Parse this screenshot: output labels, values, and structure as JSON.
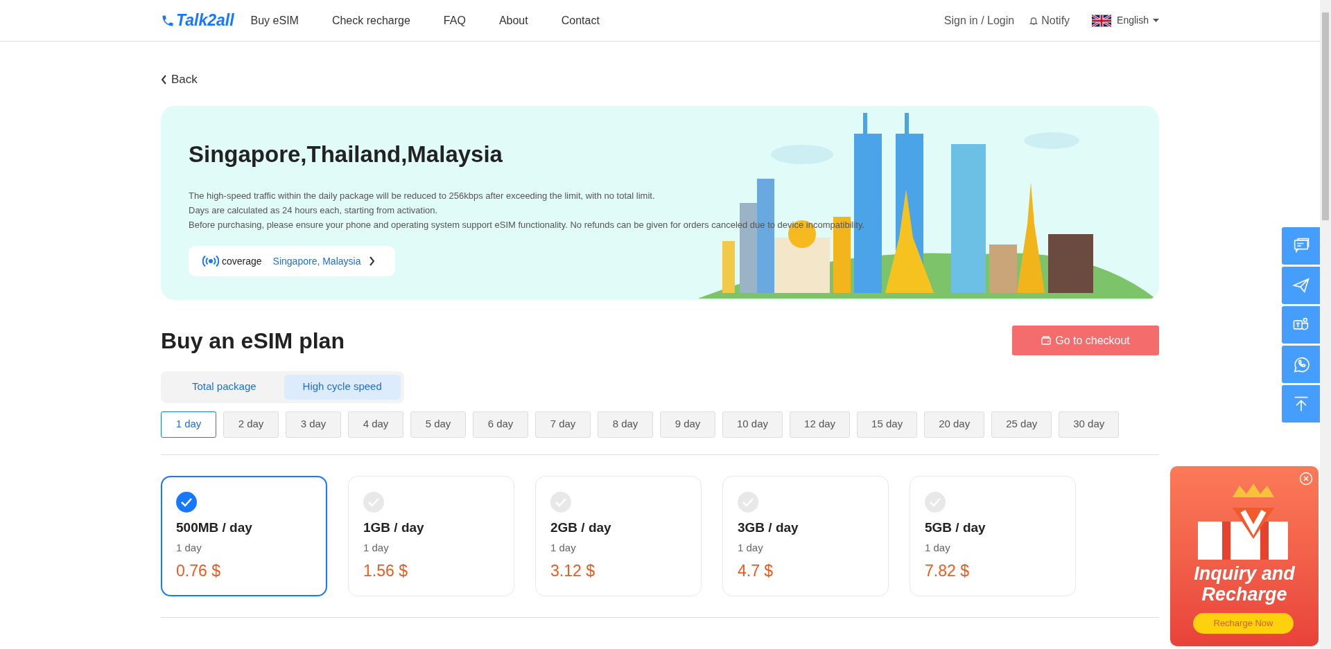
{
  "header": {
    "logo": "Talk2all",
    "nav": [
      {
        "label": "Buy eSIM"
      },
      {
        "label": "Check recharge"
      },
      {
        "label": "FAQ"
      },
      {
        "label": "About"
      },
      {
        "label": "Contact"
      }
    ],
    "sign_in": "Sign in / Login",
    "notify": "Notify",
    "language": "English"
  },
  "back": "Back",
  "banner": {
    "title": "Singapore,Thailand,Malaysia",
    "notes": [
      "The high-speed traffic within the daily package will be reduced to 256kbps after exceeding the limit, with no total limit.",
      "Days are calculated as 24 hours each, starting from activation.",
      "Before purchasing, please ensure your phone and operating system support eSIM functionality. No refunds can be given for orders canceled due to device incompatibility."
    ],
    "coverage_label": "coverage",
    "coverage_value": "Singapore, Malaysia"
  },
  "plan": {
    "title": "Buy an eSIM plan",
    "checkout": "Go to checkout",
    "tabs": [
      {
        "label": "Total package",
        "selected": false
      },
      {
        "label": "High cycle speed",
        "selected": true
      }
    ],
    "days": [
      {
        "label": "1 day",
        "selected": true
      },
      {
        "label": "2 day",
        "selected": false
      },
      {
        "label": "3 day",
        "selected": false
      },
      {
        "label": "4 day",
        "selected": false
      },
      {
        "label": "5 day",
        "selected": false
      },
      {
        "label": "6 day",
        "selected": false
      },
      {
        "label": "7 day",
        "selected": false
      },
      {
        "label": "8 day",
        "selected": false
      },
      {
        "label": "9 day",
        "selected": false
      },
      {
        "label": "10 day",
        "selected": false
      },
      {
        "label": "12 day",
        "selected": false
      },
      {
        "label": "15 day",
        "selected": false
      },
      {
        "label": "20 day",
        "selected": false
      },
      {
        "label": "25 day",
        "selected": false
      },
      {
        "label": "30 day",
        "selected": false
      }
    ],
    "packages": [
      {
        "name": "500MB / day",
        "duration": "1 day",
        "price": "0.76 $",
        "selected": true
      },
      {
        "name": "1GB / day",
        "duration": "1 day",
        "price": "1.56 $",
        "selected": false
      },
      {
        "name": "2GB / day",
        "duration": "1 day",
        "price": "3.12 $",
        "selected": false
      },
      {
        "name": "3GB / day",
        "duration": "1 day",
        "price": "4.7 $",
        "selected": false
      },
      {
        "name": "5GB / day",
        "duration": "1 day",
        "price": "7.82 $",
        "selected": false
      }
    ]
  },
  "side_buttons": [
    {
      "kind": "chat"
    },
    {
      "kind": "send"
    },
    {
      "kind": "teams"
    },
    {
      "kind": "whatsapp"
    },
    {
      "kind": "top"
    }
  ],
  "promo": {
    "title": "Inquiry and Recharge",
    "button": "Recharge Now"
  }
}
